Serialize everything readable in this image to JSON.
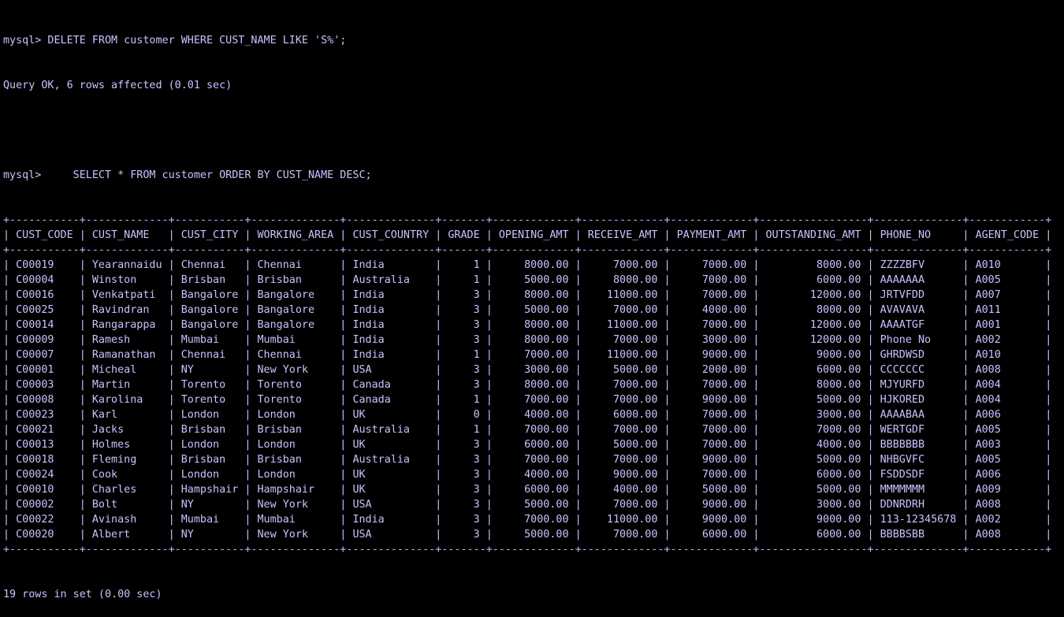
{
  "session": {
    "cmd1": {
      "prompt": "mysql>",
      "sql": " DELETE FROM customer WHERE CUST_NAME LIKE 'S%';"
    },
    "result1": "Query OK, 6 rows affected (0.01 sec)",
    "cmd2": {
      "prompt": "mysql>",
      "sql": "     SELECT * FROM customer ORDER BY CUST_NAME DESC;"
    },
    "result2": "19 rows in set (0.00 sec)"
  },
  "table": {
    "columns": [
      "CUST_CODE",
      "CUST_NAME",
      "CUST_CITY",
      "WORKING_AREA",
      "CUST_COUNTRY",
      "GRADE",
      "OPENING_AMT",
      "RECEIVE_AMT",
      "PAYMENT_AMT",
      "OUTSTANDING_AMT",
      "PHONE_NO",
      "AGENT_CODE"
    ],
    "align": [
      "l",
      "l",
      "l",
      "l",
      "l",
      "r",
      "r",
      "r",
      "r",
      "r",
      "l",
      "l"
    ],
    "rows": [
      [
        "C00019",
        "Yearannaidu",
        "Chennai",
        "Chennai",
        "India",
        "1",
        "8000.00",
        "7000.00",
        "7000.00",
        "8000.00",
        "ZZZZBFV",
        "A010"
      ],
      [
        "C00004",
        "Winston",
        "Brisban",
        "Brisban",
        "Australia",
        "1",
        "5000.00",
        "8000.00",
        "7000.00",
        "6000.00",
        "AAAAAAA",
        "A005"
      ],
      [
        "C00016",
        "Venkatpati",
        "Bangalore",
        "Bangalore",
        "India",
        "3",
        "8000.00",
        "11000.00",
        "7000.00",
        "12000.00",
        "JRTVFDD",
        "A007"
      ],
      [
        "C00025",
        "Ravindran",
        "Bangalore",
        "Bangalore",
        "India",
        "3",
        "5000.00",
        "7000.00",
        "4000.00",
        "8000.00",
        "AVAVAVA",
        "A011"
      ],
      [
        "C00014",
        "Rangarappa",
        "Bangalore",
        "Bangalore",
        "India",
        "3",
        "8000.00",
        "11000.00",
        "7000.00",
        "12000.00",
        "AAAATGF",
        "A001"
      ],
      [
        "C00009",
        "Ramesh",
        "Mumbai",
        "Mumbai",
        "India",
        "3",
        "8000.00",
        "7000.00",
        "3000.00",
        "12000.00",
        "Phone No",
        "A002"
      ],
      [
        "C00007",
        "Ramanathan",
        "Chennai",
        "Chennai",
        "India",
        "1",
        "7000.00",
        "11000.00",
        "9000.00",
        "9000.00",
        "GHRDWSD",
        "A010"
      ],
      [
        "C00001",
        "Micheal",
        "NY",
        "New York",
        "USA",
        "3",
        "3000.00",
        "5000.00",
        "2000.00",
        "6000.00",
        "CCCCCCC",
        "A008"
      ],
      [
        "C00003",
        "Martin",
        "Torento",
        "Torento",
        "Canada",
        "3",
        "8000.00",
        "7000.00",
        "7000.00",
        "8000.00",
        "MJYURFD",
        "A004"
      ],
      [
        "C00008",
        "Karolina",
        "Torento",
        "Torento",
        "Canada",
        "1",
        "7000.00",
        "7000.00",
        "9000.00",
        "5000.00",
        "HJKORED",
        "A004"
      ],
      [
        "C00023",
        "Karl",
        "London",
        "London",
        "UK",
        "0",
        "4000.00",
        "6000.00",
        "7000.00",
        "3000.00",
        "AAAABAA",
        "A006"
      ],
      [
        "C00021",
        "Jacks",
        "Brisban",
        "Brisban",
        "Australia",
        "1",
        "7000.00",
        "7000.00",
        "7000.00",
        "7000.00",
        "WERTGDF",
        "A005"
      ],
      [
        "C00013",
        "Holmes",
        "London",
        "London",
        "UK",
        "3",
        "6000.00",
        "5000.00",
        "7000.00",
        "4000.00",
        "BBBBBBB",
        "A003"
      ],
      [
        "C00018",
        "Fleming",
        "Brisban",
        "Brisban",
        "Australia",
        "3",
        "7000.00",
        "7000.00",
        "9000.00",
        "5000.00",
        "NHBGVFC",
        "A005"
      ],
      [
        "C00024",
        "Cook",
        "London",
        "London",
        "UK",
        "3",
        "4000.00",
        "9000.00",
        "7000.00",
        "6000.00",
        "FSDDSDF",
        "A006"
      ],
      [
        "C00010",
        "Charles",
        "Hampshair",
        "Hampshair",
        "UK",
        "3",
        "6000.00",
        "4000.00",
        "5000.00",
        "5000.00",
        "MMMMMMM",
        "A009"
      ],
      [
        "C00002",
        "Bolt",
        "NY",
        "New York",
        "USA",
        "3",
        "5000.00",
        "7000.00",
        "9000.00",
        "3000.00",
        "DDNRDRH",
        "A008"
      ],
      [
        "C00022",
        "Avinash",
        "Mumbai",
        "Mumbai",
        "India",
        "3",
        "7000.00",
        "11000.00",
        "9000.00",
        "9000.00",
        "113-12345678",
        "A002"
      ],
      [
        "C00020",
        "Albert",
        "NY",
        "New York",
        "USA",
        "3",
        "5000.00",
        "7000.00",
        "6000.00",
        "6000.00",
        "BBBBSBB",
        "A008"
      ]
    ]
  }
}
